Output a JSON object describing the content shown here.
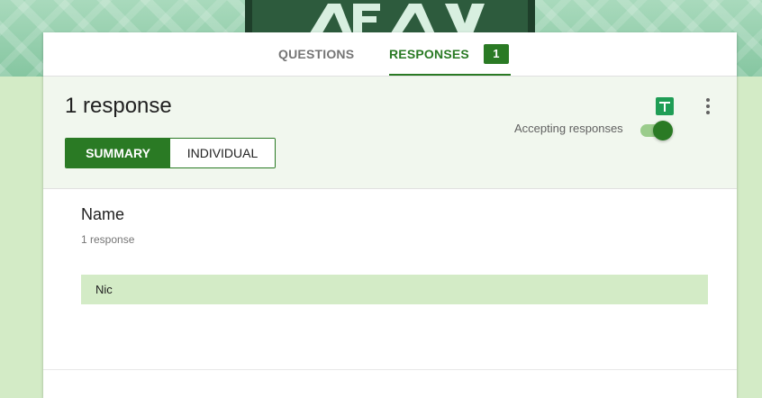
{
  "tabs": {
    "questions_label": "QUESTIONS",
    "responses_label": "RESPONSES",
    "responses_badge": "1"
  },
  "summary": {
    "response_count": "1 response",
    "summary_label": "SUMMARY",
    "individual_label": "INDIVIDUAL",
    "accepting_label": "Accepting responses",
    "accepting_on": true
  },
  "question": {
    "title": "Name",
    "subtitle": "1 response",
    "answers": [
      "Nic"
    ]
  },
  "icons": {
    "sheets": "sheets-icon",
    "more": "more-vert-icon"
  },
  "colors": {
    "accent": "#2a7a24",
    "background": "#d3ebc6",
    "header_tint": "#f1f7ee"
  }
}
